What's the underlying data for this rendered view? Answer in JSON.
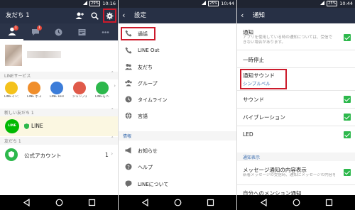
{
  "friends": {
    "time": "10:16",
    "battery": "29%",
    "title": "友だち 1",
    "tab_badge_1": "1",
    "tab_badge_2": "1",
    "line_services_label": "LINEサービス",
    "services": [
      {
        "label": "LINEマンガ LINE新",
        "color": "#f4c21c"
      },
      {
        "label": "LINE ポコポコ",
        "color": "#f08e2b"
      },
      {
        "label": "LINE Disne",
        "color": "#3c7dd9"
      },
      {
        "label": "ジャンプチ ヒー",
        "color": "#e05a4a"
      },
      {
        "label": "LINEモバイル",
        "color": "#2db84c"
      }
    ],
    "new_friends_label": "新しい友だち 1",
    "new_friend_name": "LINE",
    "friends_section_label": "友だち 1",
    "official_label": "公式アカウント",
    "official_count": "1"
  },
  "settings": {
    "time": "10:44",
    "battery": "25%",
    "title": "設定",
    "items": [
      "通話",
      "LINE Out",
      "友だち",
      "グループ",
      "タイムライン",
      "言語"
    ],
    "info_label": "情報",
    "info_items": [
      "お知らせ",
      "ヘルプ",
      "LINEについて"
    ]
  },
  "notifications": {
    "time": "10:44",
    "battery": "25%",
    "title": "通知",
    "notif_label": "通知",
    "notif_desc": "アプリを使用している時の通知については、受信できない場合があります。",
    "pause_label": "一時停止",
    "sound_label": "通知サウンド",
    "sound_value": "シンプルベル",
    "sound_toggle": "サウンド",
    "vibration": "バイブレーション",
    "led": "LED",
    "display_section": "通知表示",
    "message_content": "メッセージ通知の内容表示",
    "message_content_desc": "新着メッセージの受信時、通知にメッセージの内容を表示します。",
    "mention": "自分へのメンション通知"
  }
}
